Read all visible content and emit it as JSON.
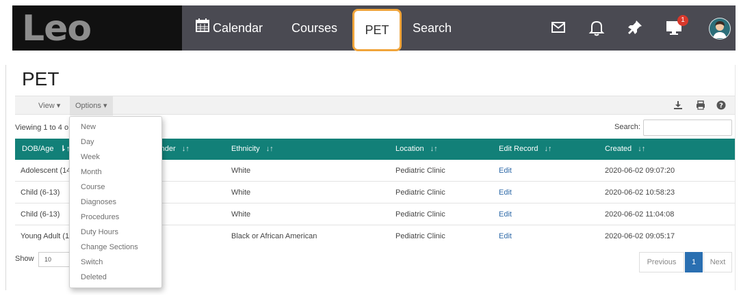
{
  "header": {
    "logo": "Leo",
    "nav": {
      "calendar": "Calendar",
      "courses": "Courses",
      "pet": "PET",
      "search": "Search"
    },
    "notification_count": "1",
    "icons": [
      "mail-icon",
      "bell-icon",
      "pin-icon",
      "monitor-icon",
      "avatar"
    ]
  },
  "page": {
    "title": "PET"
  },
  "toolbar": {
    "view_label": "View ▾",
    "options_label": "Options ▾"
  },
  "table_meta": {
    "viewing_text": "Viewing 1 to 4 o",
    "search_label": "Search:",
    "show_label": "Show",
    "show_value": "10"
  },
  "table": {
    "headers": [
      "DOB/Age",
      "Gender",
      "Ethnicity",
      "Location",
      "Edit Record",
      "Created"
    ],
    "rows": [
      {
        "dob": "Adolescent (14",
        "ethnicity": "White",
        "location": "Pediatric Clinic",
        "edit": "Edit",
        "created": "2020-06-02 09:07:20"
      },
      {
        "dob": "Child (6-13)",
        "ethnicity": "White",
        "location": "Pediatric Clinic",
        "edit": "Edit",
        "created": "2020-06-02 10:58:23"
      },
      {
        "dob": "Child (6-13)",
        "ethnicity": "White",
        "location": "Pediatric Clinic",
        "edit": "Edit",
        "created": "2020-06-02 11:04:08"
      },
      {
        "dob": "Young Adult (1",
        "ethnicity": "Black or African American",
        "location": "Pediatric Clinic",
        "edit": "Edit",
        "created": "2020-06-02 09:05:17"
      }
    ]
  },
  "pagination": {
    "previous": "Previous",
    "current": "1",
    "next": "Next"
  },
  "options_menu": {
    "items": [
      "New",
      "Day",
      "Week",
      "Month",
      "Course",
      "Diagnoses",
      "Procedures",
      "Duty Hours",
      "Change Sections",
      "Switch",
      "Deleted"
    ]
  },
  "colors": {
    "table_header": "#128078",
    "nav_bg": "#4a4a52",
    "active_tab_border": "#f0a43a",
    "active_page": "#2a6fb1"
  }
}
